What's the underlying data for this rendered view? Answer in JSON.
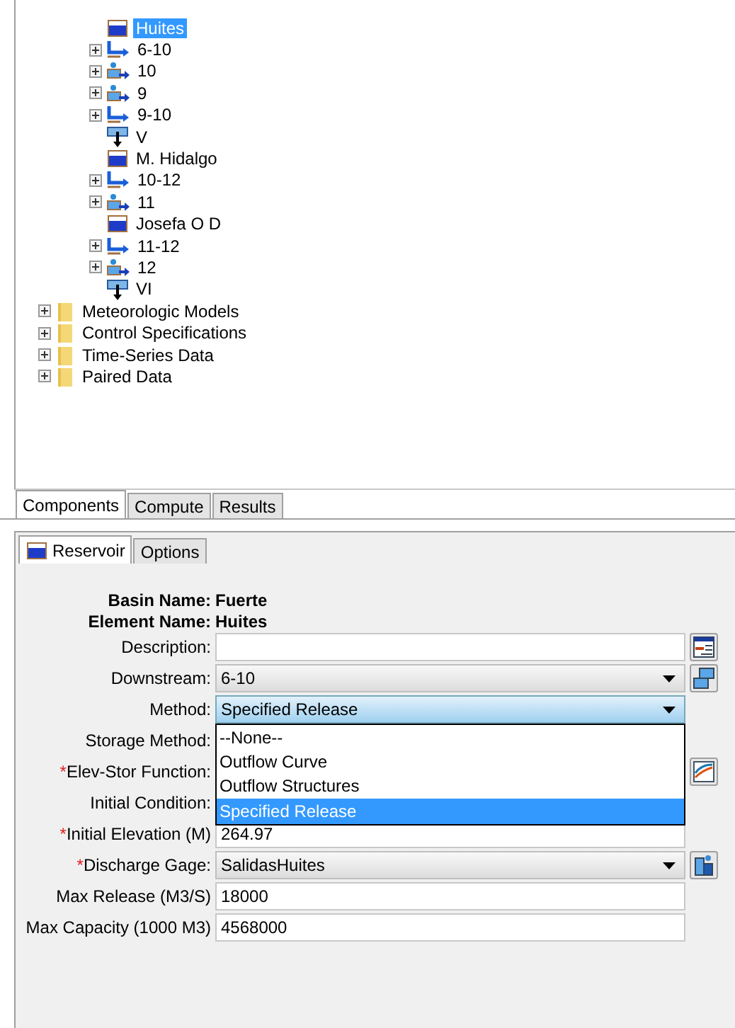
{
  "tree": {
    "elements": [
      {
        "label": "Huites",
        "kind": "reservoir",
        "selected": true,
        "expandable": false
      },
      {
        "label": "6-10",
        "kind": "reach",
        "selected": false,
        "expandable": true
      },
      {
        "label": "10",
        "kind": "subbasin",
        "selected": false,
        "expandable": true
      },
      {
        "label": "9",
        "kind": "subbasin",
        "selected": false,
        "expandable": true
      },
      {
        "label": "9-10",
        "kind": "reach",
        "selected": false,
        "expandable": true
      },
      {
        "label": "V",
        "kind": "junction",
        "selected": false,
        "expandable": false
      },
      {
        "label": "M. Hidalgo",
        "kind": "reservoir",
        "selected": false,
        "expandable": false
      },
      {
        "label": "10-12",
        "kind": "reach",
        "selected": false,
        "expandable": true
      },
      {
        "label": "11",
        "kind": "subbasin",
        "selected": false,
        "expandable": true
      },
      {
        "label": "Josefa O D",
        "kind": "reservoir",
        "selected": false,
        "expandable": false
      },
      {
        "label": "11-12",
        "kind": "reach",
        "selected": false,
        "expandable": true
      },
      {
        "label": "12",
        "kind": "subbasin",
        "selected": false,
        "expandable": true
      },
      {
        "label": "VI",
        "kind": "junction",
        "selected": false,
        "expandable": false
      }
    ],
    "folders": [
      {
        "label": "Meteorologic Models",
        "selected": false
      },
      {
        "label": "Control Specifications",
        "selected": false
      },
      {
        "label": "Time-Series Data",
        "selected": false
      },
      {
        "label": "Paired Data",
        "selected": false
      }
    ]
  },
  "explorer_tabs": [
    {
      "label": "Components",
      "selected": true
    },
    {
      "label": "Compute",
      "selected": false
    },
    {
      "label": "Results",
      "selected": false
    }
  ],
  "editor_tabs": [
    {
      "label": "Reservoir",
      "selected": true,
      "kind": "reservoir"
    },
    {
      "label": "Options",
      "selected": false,
      "kind": "plain"
    }
  ],
  "form": [
    {
      "kind": "info",
      "label": "Basin Name:",
      "value": "Fuerte"
    },
    {
      "kind": "info",
      "label": "Element Name:",
      "value": "Huites"
    },
    {
      "kind": "text",
      "label": "Description:",
      "has_button": true
    },
    {
      "kind": "select",
      "label": "Downstream:",
      "value": "6-10",
      "has_button": true
    },
    {
      "kind": "select",
      "label": "Method:",
      "value": "Specified Release",
      "open": true
    },
    {
      "kind": "covered",
      "label": "Storage Method:"
    },
    {
      "kind": "covered",
      "label": "Elev-Stor Function:",
      "marker": "*",
      "has_button": true
    },
    {
      "kind": "covered",
      "label": "Initial Condition:"
    },
    {
      "kind": "text",
      "label": "Initial Elevation (M)",
      "marker": "*",
      "value": "264.97"
    },
    {
      "kind": "select",
      "label": "Discharge Gage:",
      "marker": "*",
      "value": "SalidasHuites",
      "has_button": true
    },
    {
      "kind": "text",
      "label": "Max Release (M3/S)",
      "value": "18000"
    },
    {
      "kind": "text",
      "label": "Max Capacity (1000 M3)",
      "value": "4568000"
    }
  ],
  "method_options": [
    {
      "label": "--None--",
      "selected": false
    },
    {
      "label": "Outflow Curve",
      "selected": false
    },
    {
      "label": "Outflow Structures",
      "selected": false
    },
    {
      "label": "Specified Release",
      "selected": true
    }
  ]
}
